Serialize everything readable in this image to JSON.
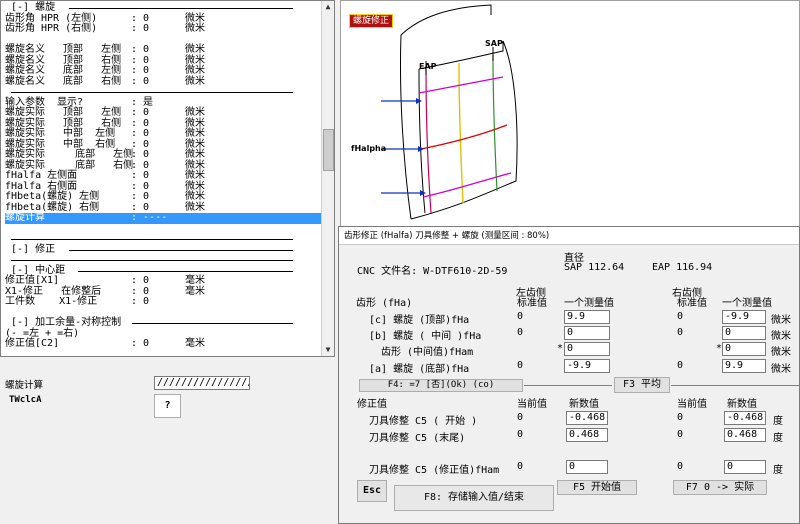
{
  "list_lines": [
    {
      "type": "sep",
      "text": "[-] 螺旋"
    },
    {
      "type": "row",
      "c1": "齿形角 HPR (左侧)",
      "c2": ": 0",
      "c3": "微米"
    },
    {
      "type": "row",
      "c1": "齿形角 HPR (右侧)",
      "c2": ": 0",
      "c3": "微米"
    },
    {
      "type": "blank"
    },
    {
      "type": "row",
      "c1": "螺旋名义   顶部   左侧",
      "c2": ": 0",
      "c3": "微米"
    },
    {
      "type": "row",
      "c1": "螺旋名义   顶部   右侧",
      "c2": ": 0",
      "c3": "微米"
    },
    {
      "type": "row",
      "c1": "螺旋名义   底部   左侧",
      "c2": ": 0",
      "c3": "微米"
    },
    {
      "type": "row",
      "c1": "螺旋名义   底部   右侧",
      "c2": ": 0",
      "c3": "微米"
    },
    {
      "type": "sep",
      "text": ""
    },
    {
      "type": "row",
      "c1": "输入参数  显示?",
      "c2": ": 是",
      "c3": ""
    },
    {
      "type": "row",
      "c1": "螺旋实际   顶部   左侧",
      "c2": ": 0",
      "c3": "微米"
    },
    {
      "type": "row",
      "c1": "螺旋实际   顶部   右侧",
      "c2": ": 0",
      "c3": "微米"
    },
    {
      "type": "row",
      "c1": "螺旋实际   中部  左侧",
      "c2": ": 0",
      "c3": "微米"
    },
    {
      "type": "row",
      "c1": "螺旋实际   中部  右侧",
      "c2": ": 0",
      "c3": "微米"
    },
    {
      "type": "row",
      "c1": "螺旋实际     底部   左侧",
      "c2": ": 0",
      "c3": "微米"
    },
    {
      "type": "row",
      "c1": "螺旋实际     底部   右侧",
      "c2": ": 0",
      "c3": "微米"
    },
    {
      "type": "row",
      "c1": "fHalfa 左侧面",
      "c2": ": 0",
      "c3": "微米"
    },
    {
      "type": "row",
      "c1": "fHalfa 右侧面",
      "c2": ": 0",
      "c3": "微米"
    },
    {
      "type": "row",
      "c1": "fHbeta(螺旋) 左侧",
      "c2": ": 0",
      "c3": "微米"
    },
    {
      "type": "row",
      "c1": "fHbeta(螺旋) 右侧",
      "c2": ": 0",
      "c3": "微米"
    },
    {
      "type": "sel",
      "c1": "螺旋计算",
      "c2": ": ----",
      "c3": ""
    },
    {
      "type": "blank"
    },
    {
      "type": "sep",
      "text": ""
    },
    {
      "type": "sep",
      "text": "[-] 修正"
    },
    {
      "type": "sep",
      "text": ""
    },
    {
      "type": "sep",
      "text": "[-] 中心距"
    },
    {
      "type": "row",
      "c1": "修正值[X1]",
      "c2": ": 0",
      "c3": "毫米"
    },
    {
      "type": "row",
      "c1": "X1-修正   在修整后",
      "c2": ": 0",
      "c3": "毫米"
    },
    {
      "type": "row",
      "c1": "工件数    X1-修正",
      "c2": ": 0",
      "c3": ""
    },
    {
      "type": "blank"
    },
    {
      "type": "sep",
      "text": "[-] 加工余量-对称控制"
    },
    {
      "type": "row",
      "c1": "(- =左 + =右)",
      "c2": "",
      "c3": ""
    },
    {
      "type": "row",
      "c1": "修正值[C2]",
      "c2": ": 0",
      "c3": "毫米"
    }
  ],
  "lower_left": {
    "label": "螺旋计算",
    "field_value": "////////////////",
    "code": "TWclcA",
    "help_button": "?"
  },
  "image": {
    "badge": "螺旋修正",
    "eap": "EAP",
    "sap": "SAP",
    "fhalpha": "fHalpha"
  },
  "dialog": {
    "title": "齿形修正 (fHalfa) 刀具修整   + 螺旋 (测量区间 : 80%)",
    "zhijing": "直径",
    "cnc_file": "CNC 文件名: W-DTF610-2D-59",
    "sap": "SAP 112.64",
    "eap": "EAP 116.94",
    "left_flank": "左齿侧",
    "right_flank": "右齿侧",
    "std_value": "标准值",
    "meas_value": "一个测量值",
    "profile_label": "齿形 (fHa)",
    "rows": [
      {
        "label": "[c] 螺旋 (顶部)fHa",
        "lstd": "0",
        "lval": "9.9",
        "rstd": "0",
        "rval": "-9.9",
        "unit": "微米",
        "lstar": "",
        "rstar": ""
      },
      {
        "label": "[b] 螺旋 ( 中间 )fHa",
        "lstd": "0",
        "lval": "0",
        "rstd": "0",
        "rval": "0",
        "unit": "微米",
        "lstar": "",
        "rstar": ""
      },
      {
        "label": "齿形 (中间值)fHam",
        "lstd": "",
        "lval": "0",
        "rstd": "",
        "rval": "0",
        "unit": "微米",
        "lstar": "*",
        "rstar": "*"
      },
      {
        "label": "[a] 螺旋 (底部)fHa",
        "lstd": "0",
        "lval": "-9.9",
        "rstd": "0",
        "rval": "9.9",
        "unit": "微米",
        "lstar": "",
        "rstar": ""
      }
    ],
    "f4_button": "F4: =7 [否](Ok) (co)",
    "f3_button": "F3 平均",
    "correction_label": "修正值",
    "current_value": "当前值",
    "new_value": "新数值",
    "c5_rows": [
      {
        "label": "刀具修整 C5 ( 开始 )",
        "lcur": "0",
        "lnew": "-0.468",
        "rcur": "0",
        "rnew": "-0.468",
        "unit": "度"
      },
      {
        "label": "刀具修整 C5 (末尾)",
        "lcur": "0",
        "lnew": "0.468",
        "rcur": "0",
        "rnew": "0.468",
        "unit": "度"
      }
    ],
    "c5m": {
      "label": "刀具修整 C5 (修正值)fHam",
      "lcur": "0",
      "lnew": "0",
      "rcur": "0",
      "rnew": "0",
      "unit": "度"
    },
    "esc_button": "Esc",
    "f8_button": "F8: 存储输入值/结束",
    "f5_button": "F5 开始值",
    "f7_button": "F7 0 -> 实际"
  }
}
